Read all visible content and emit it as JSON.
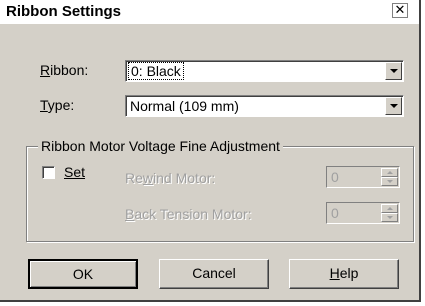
{
  "window": {
    "title": "Ribbon Settings",
    "close_glyph": "✕"
  },
  "form": {
    "ribbon": {
      "label": "Ribbon:",
      "label_hotkey": "R",
      "label_rest": "ibbon:",
      "value": "0: Black"
    },
    "type": {
      "label": "Type:",
      "label_hotkey": "T",
      "label_rest": "ype:",
      "value": "Normal (109 mm)"
    }
  },
  "group": {
    "legend": "Ribbon Motor Voltage Fine Adjustment",
    "set": {
      "label": "Set",
      "checked": false
    },
    "rewind": {
      "label_pre": "Re",
      "label_hotkey": "w",
      "label_post": "ind Motor:",
      "value": "0"
    },
    "back_tension": {
      "label_hotkey": "B",
      "label_post": "ack Tension Motor:",
      "value": "0"
    }
  },
  "buttons": {
    "ok": "OK",
    "cancel": "Cancel",
    "help_hotkey": "H",
    "help_rest": "elp"
  },
  "icons": {
    "close": "close-icon",
    "dropdown": "chevron-down-icon"
  }
}
